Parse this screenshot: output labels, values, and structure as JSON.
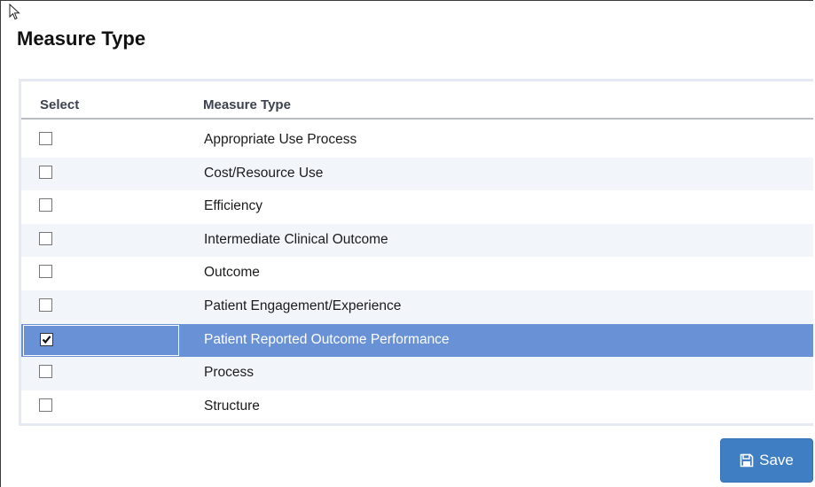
{
  "page": {
    "title": "Measure Type"
  },
  "grid": {
    "columns": {
      "select": "Select",
      "measure_type": "Measure Type"
    },
    "rows": [
      {
        "label": "Appropriate Use Process",
        "checked": false
      },
      {
        "label": "Cost/Resource Use",
        "checked": false
      },
      {
        "label": "Efficiency",
        "checked": false
      },
      {
        "label": "Intermediate Clinical Outcome",
        "checked": false
      },
      {
        "label": "Outcome",
        "checked": false
      },
      {
        "label": "Patient Engagement/Experience",
        "checked": false
      },
      {
        "label": "Patient Reported Outcome Performance",
        "checked": true
      },
      {
        "label": "Process",
        "checked": false
      },
      {
        "label": "Structure",
        "checked": false
      }
    ]
  },
  "actions": {
    "save_label": "Save",
    "save_icon": "floppy-disk-icon"
  },
  "colors": {
    "selected_row": "#6891d6",
    "alt_row": "#f2f6fb",
    "save_button": "#3f7ec2",
    "grid_border": "#e4e9f2"
  }
}
